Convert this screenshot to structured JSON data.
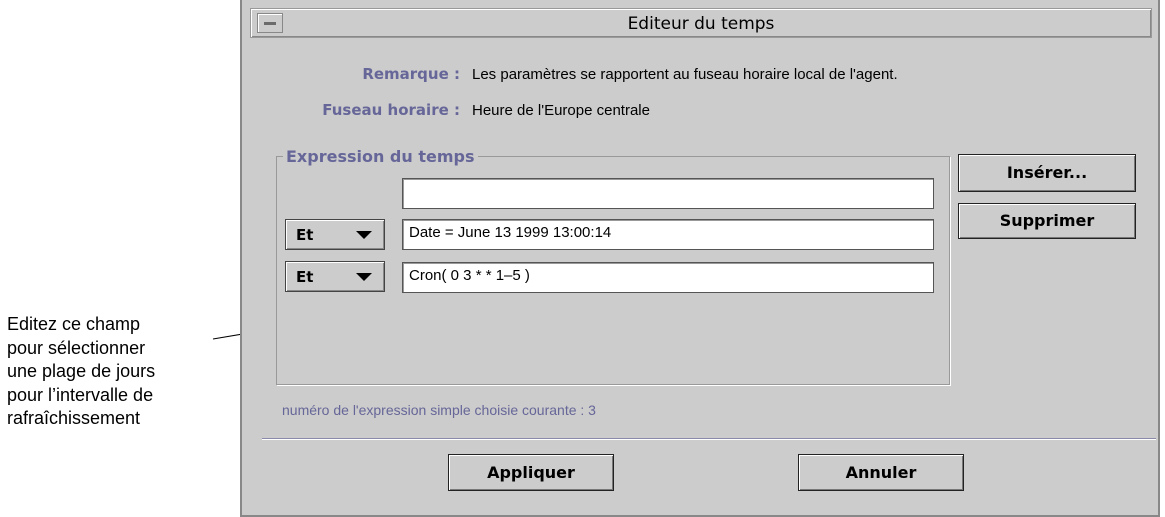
{
  "callout": {
    "lines": [
      "Editez ce champ",
      "pour sélectionner",
      "une plage de jours",
      "pour l’intervalle de",
      "rafraîchissement"
    ]
  },
  "window": {
    "title": "Editeur du temps",
    "remark_label": "Remarque :",
    "remark_value": "Les paramètres se rapportent au fuseau horaire local de l'agent.",
    "timezone_label": "Fuseau horaire :",
    "timezone_value": "Heure de l'Europe centrale",
    "group_title": "Expression du temps",
    "expressions": [
      {
        "operator": "",
        "value": ""
      },
      {
        "operator": "Et",
        "value": "Date = June 13 1999 13:00:14"
      },
      {
        "operator": "Et",
        "value": "Cron( 0 3 * * 1–5 )"
      }
    ],
    "insert_label": "Insérer...",
    "delete_label": "Supprimer",
    "status_text": "numéro de l'expression simple choisie courante : 3",
    "apply_label": "Appliquer",
    "cancel_label": "Annuler"
  }
}
